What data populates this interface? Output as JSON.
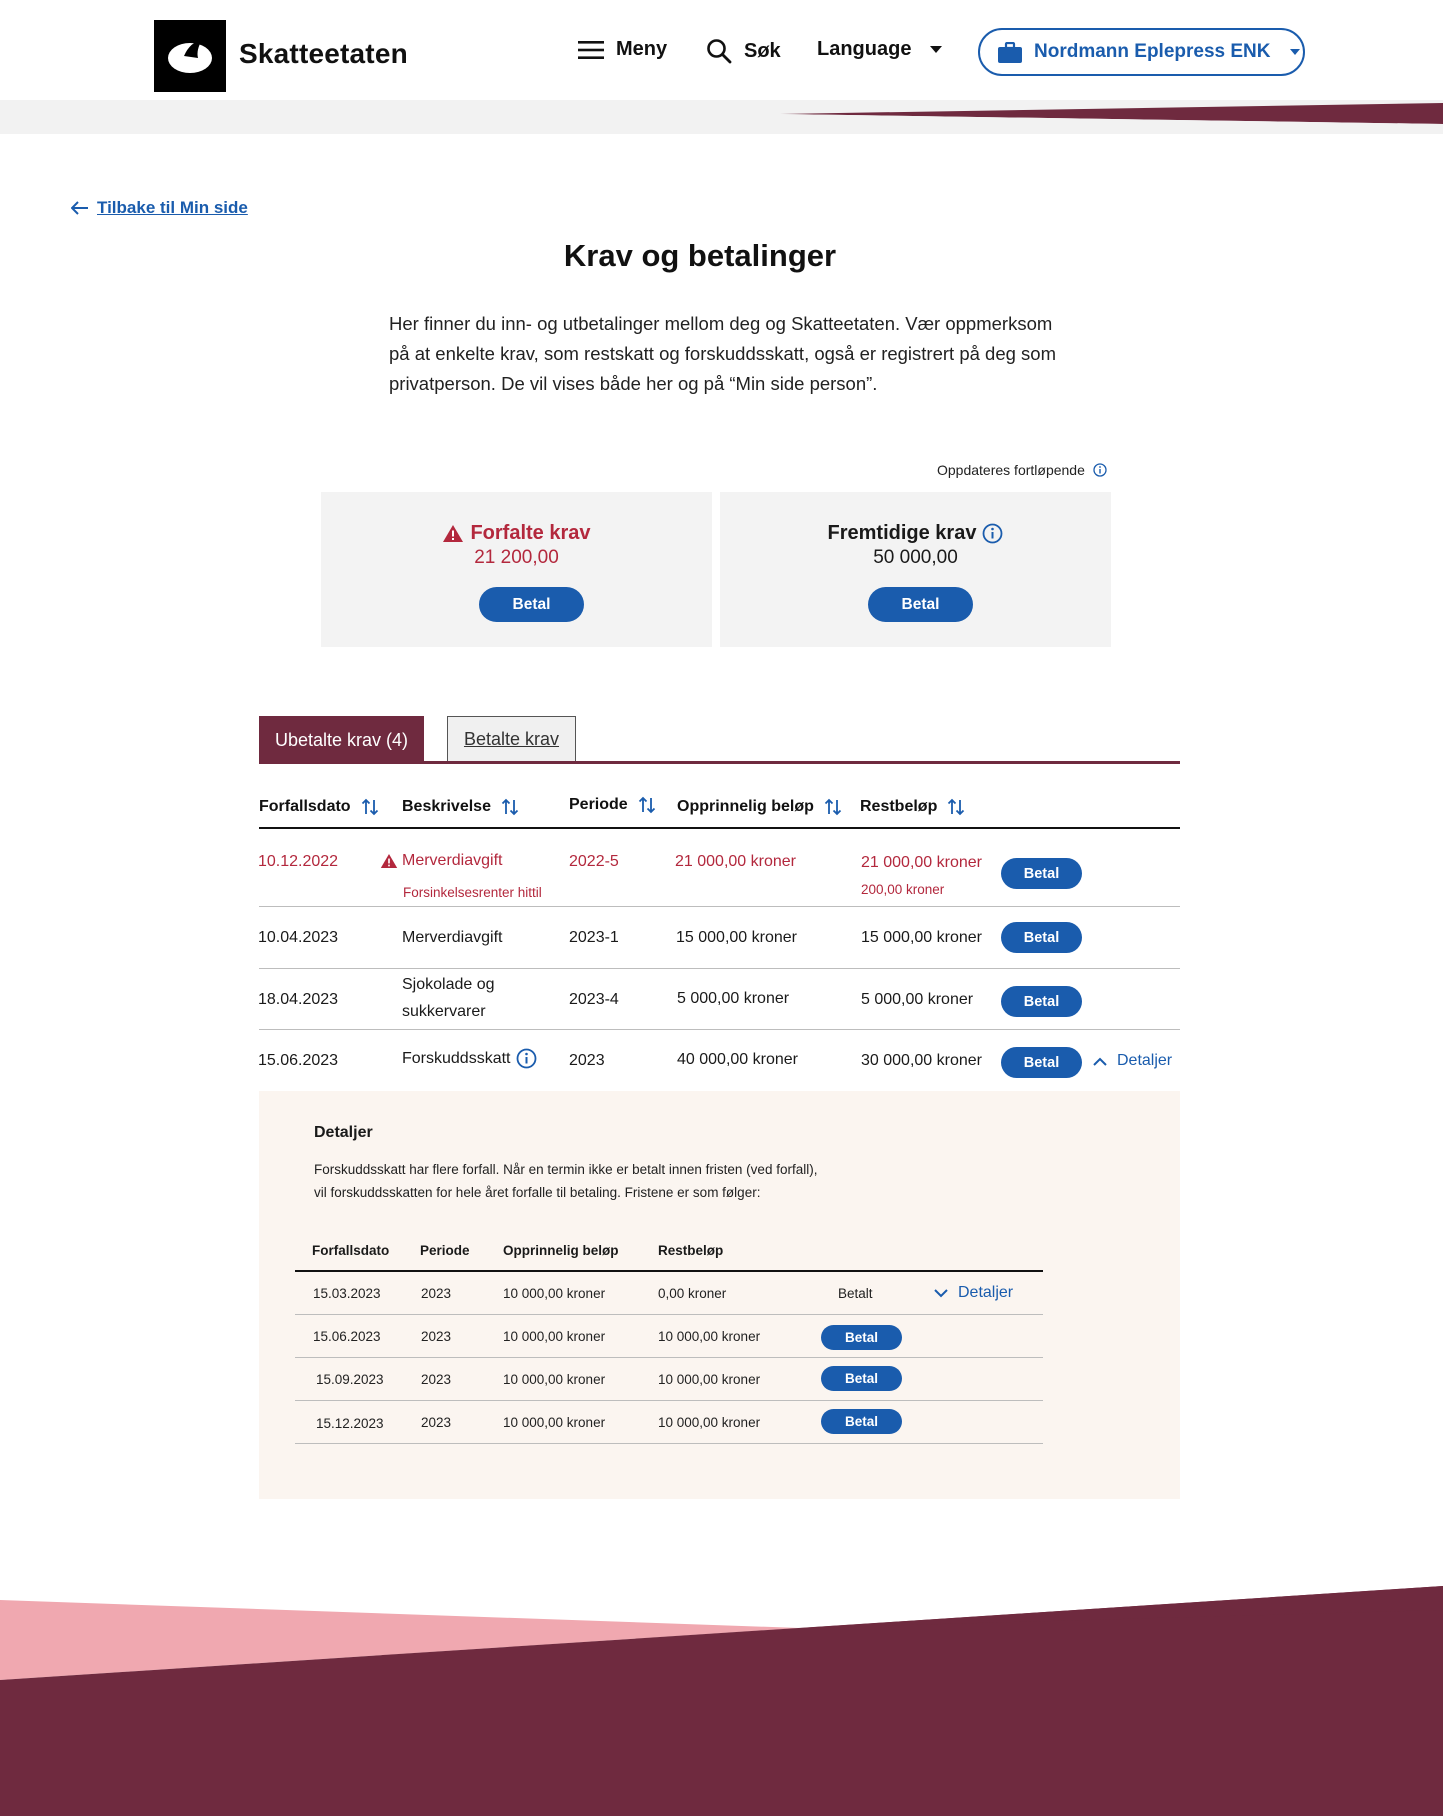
{
  "header": {
    "logo_text": "Skatteetaten",
    "menu_label": "Meny",
    "search_label": "Søk",
    "language_label": "Language",
    "org_label": "Nordmann Eplepress ENK"
  },
  "back_link": "Tilbake til Min side",
  "page_title": "Krav og betalinger",
  "intro": "Her finner du inn- og utbetalinger mellom deg og Skatteetaten. Vær oppmerksom på at enkelte krav, som restskatt og forskuddsskatt, også er registrert på deg som privatperson. De vil vises både her og på “Min side person”.",
  "updated_text": "Oppdateres fortløpende",
  "cards": {
    "overdue": {
      "title": "Forfalte krav",
      "amount": "21 200,00",
      "button": "Betal"
    },
    "future": {
      "title": "Fremtidige krav",
      "amount": "50 000,00",
      "button": "Betal"
    }
  },
  "tabs": {
    "unpaid": "Ubetalte krav (4)",
    "paid": "Betalte krav"
  },
  "table": {
    "headers": [
      "Forfallsdato",
      "Beskrivelse",
      "Periode",
      "Opprinnelig beløp",
      "Restbeløp"
    ],
    "rows": [
      {
        "date": "10.12.2022",
        "description": "Merverdiavgift",
        "sub_description": "Forsinkelsesrenter hittil",
        "period": "2022-5",
        "original": "21 000,00 kroner",
        "remaining": "21 000,00 kroner",
        "sub_remaining": "200,00 kroner",
        "button": "Betal",
        "status": "overdue"
      },
      {
        "date": "10.04.2023",
        "description": "Merverdiavgift",
        "period": "2023-1",
        "original": "15 000,00 kroner",
        "remaining": "15 000,00 kroner",
        "button": "Betal"
      },
      {
        "date": "18.04.2023",
        "description_line1": "Sjokolade og",
        "description_line2": "sukkervarer",
        "period": "2023-4",
        "original": "5 000,00 kroner",
        "remaining": "5 000,00 kroner",
        "button": "Betal"
      },
      {
        "date": "15.06.2023",
        "description": "Forskuddsskatt",
        "period": "2023",
        "original": "40 000,00 kroner",
        "remaining": "30 000,00 kroner",
        "button": "Betal",
        "details_label": "Detaljer"
      }
    ]
  },
  "details": {
    "title": "Detaljer",
    "text_line1": "Forskuddsskatt har flere forfall. Når en termin ikke er betalt innen fristen (ved forfall),",
    "text_line2": "vil forskuddsskatten for hele året forfalle til betaling. Fristene er som følger:",
    "headers": [
      "Forfallsdato",
      "Periode",
      "Opprinnelig beløp",
      "Restbeløp"
    ],
    "rows": [
      {
        "date": "15.03.2023",
        "period": "2023",
        "original": "10 000,00 kroner",
        "remaining": "0,00 kroner",
        "status": "Betalt",
        "details_label": "Detaljer"
      },
      {
        "date": "15.06.2023",
        "period": "2023",
        "original": "10 000,00 kroner",
        "remaining": "10 000,00 kroner",
        "button": "Betal"
      },
      {
        "date": "15.09.2023",
        "period": "2023",
        "original": "10 000,00 kroner",
        "remaining": "10 000,00 kroner",
        "button": "Betal"
      },
      {
        "date": "15.12.2023",
        "period": "2023",
        "original": "10 000,00 kroner",
        "remaining": "10 000,00 kroner",
        "button": "Betal"
      }
    ]
  },
  "colors": {
    "brand_blue": "#1a5cad",
    "burgundy": "#6f2a3f",
    "alert_red": "#b3283d",
    "pink": "#f0a8b0",
    "panel_bg": "#fbf5f0",
    "card_bg": "#f3f3f3"
  },
  "icons": [
    "menu-icon",
    "search-icon",
    "chevron-down-icon",
    "briefcase-icon",
    "arrow-left-icon",
    "info-icon",
    "warning-icon",
    "sort-icon",
    "chevron-up-icon"
  ]
}
